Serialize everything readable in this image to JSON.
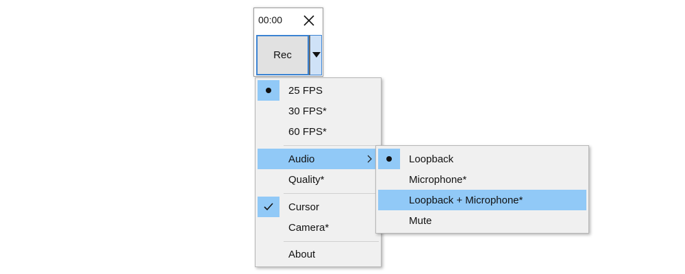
{
  "recorder": {
    "timer": "00:00",
    "rec_label": "Rec",
    "icons": {
      "close": "close-x-icon",
      "dropdown": "triangle-down-icon"
    }
  },
  "menu": {
    "items": [
      {
        "label": "25 FPS",
        "checked": "dot"
      },
      {
        "label": "30 FPS*"
      },
      {
        "label": "60 FPS*"
      },
      {
        "label": "Audio",
        "submenu": true,
        "highlighted": true
      },
      {
        "label": "Quality*"
      },
      {
        "label": "Cursor",
        "checked": "check"
      },
      {
        "label": "Camera*"
      },
      {
        "label": "About"
      }
    ]
  },
  "audio_submenu": {
    "items": [
      {
        "label": "Loopback",
        "checked": "dot"
      },
      {
        "label": "Microphone*"
      },
      {
        "label": "Loopback + Microphone*",
        "highlighted": true
      },
      {
        "label": "Mute"
      }
    ]
  },
  "colors": {
    "highlight": "#91c9f7",
    "menu_bg": "#f0f0f0",
    "focus_border": "#3a82d2"
  }
}
